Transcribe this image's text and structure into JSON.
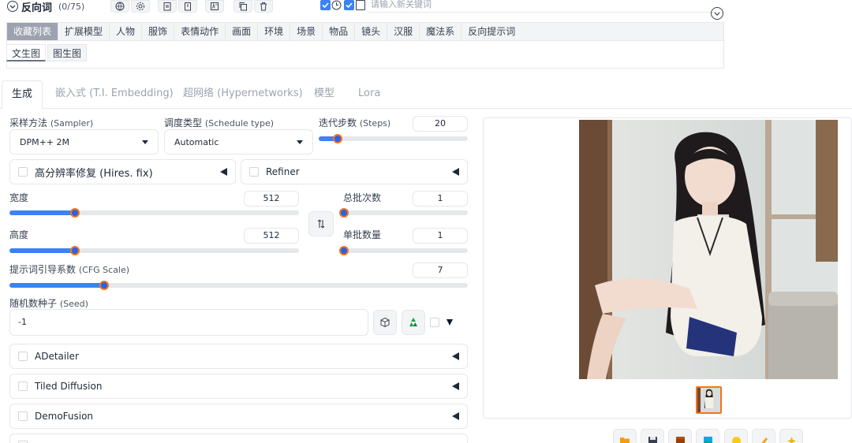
{
  "negative": {
    "title": "反向词",
    "count": "(0/75)",
    "keyword_placeholder": "请输入新关键词"
  },
  "category_tabs": [
    "收藏列表",
    "扩展模型",
    "人物",
    "服饰",
    "表情动作",
    "画面",
    "环境",
    "场景",
    "物品",
    "镜头",
    "汉服",
    "魔法系",
    "反向提示词"
  ],
  "sub_tabs": [
    "文生图",
    "图生图"
  ],
  "main_tabs": [
    "生成",
    "嵌入式 (T.I. Embedding)",
    "超网络 (Hypernetworks)",
    "模型",
    "Lora"
  ],
  "sampler": {
    "label": "采样方法",
    "hint": "(Sampler)",
    "value": "DPM++ 2M"
  },
  "schedule": {
    "label": "调度类型",
    "hint": "(Schedule type)",
    "value": "Automatic"
  },
  "steps": {
    "label": "迭代步数",
    "hint": "(Steps)",
    "value": "20",
    "min": 1,
    "max": 150
  },
  "hires": {
    "label": "高分辨率修复 (Hires. fix)"
  },
  "refiner": {
    "label": "Refiner"
  },
  "width": {
    "label": "宽度",
    "value": "512",
    "min": 64,
    "max": 2048
  },
  "height": {
    "label": "高度",
    "value": "512",
    "min": 64,
    "max": 2048
  },
  "batch_count": {
    "label": "总批次数",
    "value": "1",
    "min": 1,
    "max": 100
  },
  "batch_size": {
    "label": "单批数量",
    "value": "1",
    "min": 1,
    "max": 8
  },
  "cfg": {
    "label": "提示词引导系数",
    "hint": "(CFG Scale)",
    "value": "7",
    "min": 1,
    "max": 30
  },
  "seed": {
    "label": "随机数种子",
    "hint": "(Seed)",
    "value": "-1"
  },
  "extensions": [
    "ADetailer",
    "Tiled Diffusion",
    "DemoFusion"
  ],
  "icons": {
    "swap": "swap-arrows-icon",
    "dice": "dice-icon",
    "recycle": "recycle-icon"
  },
  "colors": {
    "accent": "#3b82f6",
    "thumb_border": "#f97316",
    "active_tab": "#9ca3af"
  }
}
